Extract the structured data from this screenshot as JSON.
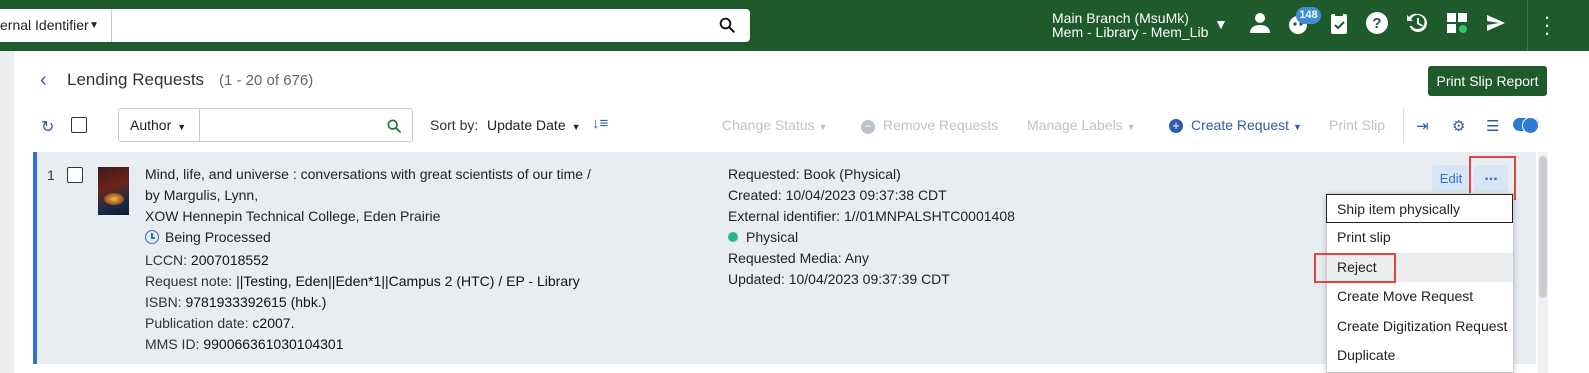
{
  "topbar": {
    "search_scope": "ernal Identifier",
    "branch_line1": "Main Branch (MsuMk)",
    "branch_line2": "Mem - Library - Mem_Lib",
    "tasks_badge": "148",
    "icons": [
      "user-icon",
      "tasks-icon",
      "clipboard-icon",
      "help-icon",
      "history-icon",
      "widgets-icon",
      "plane-icon",
      "kebab-menu-icon"
    ]
  },
  "header": {
    "title": "Lending Requests",
    "count": "(1 - 20 of 676)",
    "print_report": "Print Slip Report"
  },
  "toolbar": {
    "search_field": "Author",
    "search_value": "",
    "sort_by_label": "Sort by:",
    "sort_by_value": "Update Date",
    "change_status": "Change Status",
    "remove_requests": "Remove Requests",
    "manage_labels": "Manage Labels",
    "create_request": "Create Request",
    "print_slip": "Print Slip"
  },
  "row": {
    "number": "1",
    "title": "Mind, life, and universe : conversations with great scientists of our time /",
    "author_prefix": "by",
    "author": "Margulis, Lynn,",
    "partner": "XOW Hennepin Technical College, Eden Prairie",
    "status": "Being Processed",
    "lccn_label": "LCCN:",
    "lccn": "2007018552",
    "request_note_label": "Request note:",
    "request_note": "||Testing, Eden||Eden*1||Campus 2 (HTC) / EP - Library",
    "isbn_label": "ISBN:",
    "isbn": "9781933392615 (hbk.)",
    "pub_date_label": "Publication date:",
    "pub_date": "c2007.",
    "mms_label": "MMS ID:",
    "mms": "990066361030104301",
    "requested_label": "Requested:",
    "requested": "Book (Physical)",
    "created_label": "Created:",
    "created": "10/04/2023 09:37:38 CDT",
    "ext_id_label": "External identifier:",
    "ext_id": "1//01MNPALSHTC0001408",
    "format": "Physical",
    "media_label": "Requested Media:",
    "media": "Any",
    "updated_label": "Updated:",
    "updated": "10/04/2023 09:37:39 CDT",
    "edit": "Edit",
    "more": "..."
  },
  "menu": {
    "items": [
      "Ship item physically",
      "Print slip",
      "Reject",
      "Create Move Request",
      "Create Digitization Request",
      "Duplicate"
    ]
  },
  "colors": {
    "topbar": "#1e5a2b",
    "accent": "#2e6fd4",
    "highlight": "#e0443c"
  }
}
